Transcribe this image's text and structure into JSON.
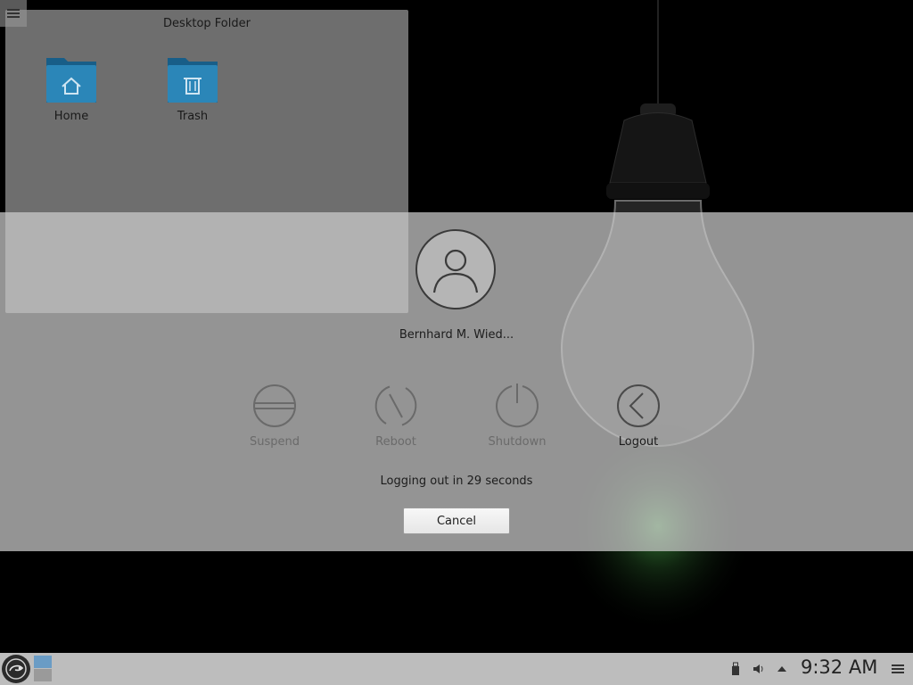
{
  "desktop_folder": {
    "title": "Desktop Folder",
    "items": [
      {
        "label": "Home",
        "icon": "home-folder-icon"
      },
      {
        "label": "Trash",
        "icon": "trash-folder-icon"
      }
    ]
  },
  "logout_dialog": {
    "user_name": "Bernhard M. Wied...",
    "actions": [
      {
        "label": "Suspend",
        "icon": "suspend-icon"
      },
      {
        "label": "Reboot",
        "icon": "reboot-icon"
      },
      {
        "label": "Shutdown",
        "icon": "shutdown-icon"
      },
      {
        "label": "Logout",
        "icon": "logout-icon"
      }
    ],
    "countdown_text": "Logging out in 29 seconds",
    "cancel_label": "Cancel"
  },
  "taskbar": {
    "clock": "9:32 AM"
  },
  "colors": {
    "folder_blue": "#1f6f9e",
    "pager_active": "#6a9cc5",
    "overlay": "#cdcdcd"
  }
}
